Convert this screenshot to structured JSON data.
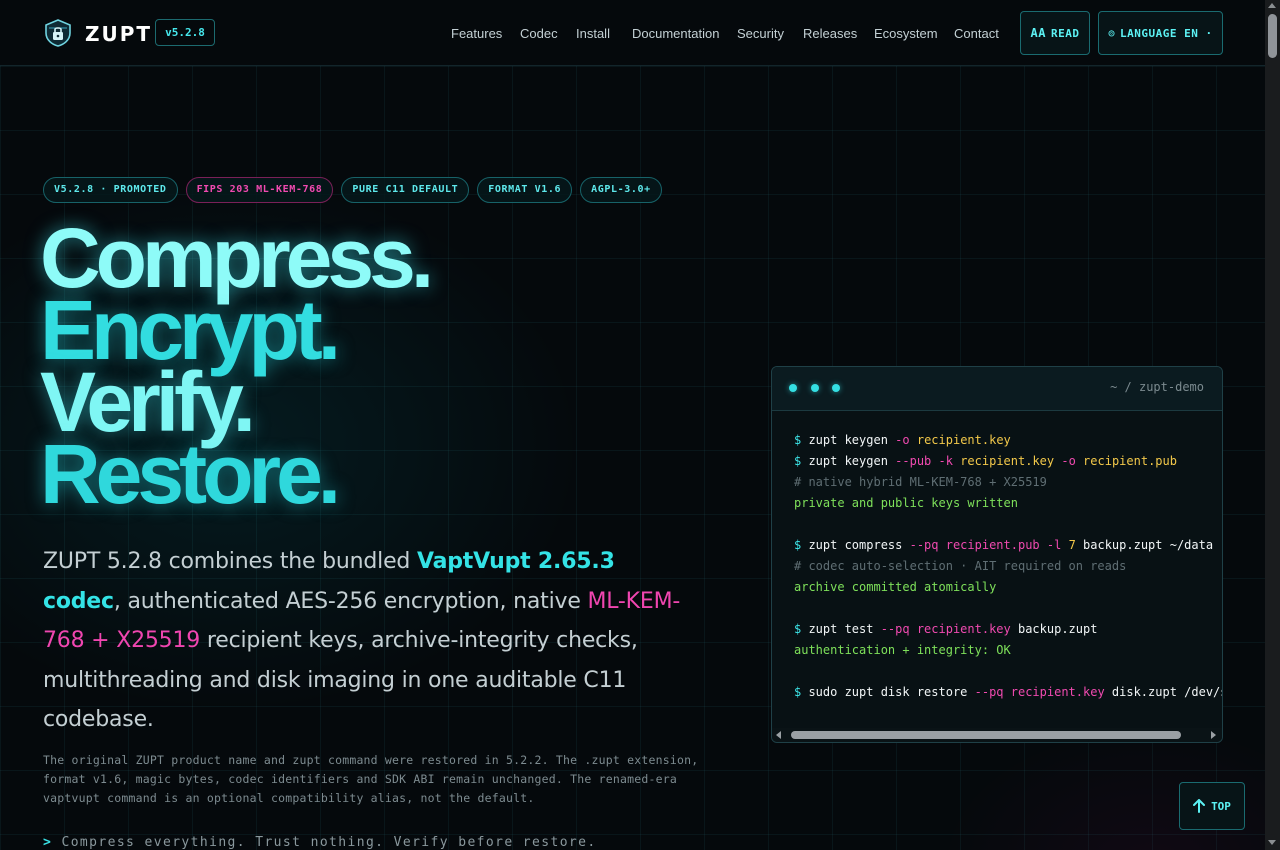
{
  "header": {
    "brand": "ZUPT",
    "version": "v5.2.8",
    "nav": [
      {
        "label": "Features"
      },
      {
        "label": "Codec"
      },
      {
        "label": "Install"
      },
      {
        "label": "Documentation"
      },
      {
        "label": "Security"
      },
      {
        "label": "Releases"
      },
      {
        "label": "Ecosystem"
      },
      {
        "label": "Contact"
      }
    ],
    "read_label": "READ",
    "read_icon_text": "AA",
    "language_label": "LANGUAGE EN ·",
    "language_icon_text": "◎"
  },
  "badges": [
    {
      "label": "V5.2.8 · PROMOTED",
      "accent": "cyan"
    },
    {
      "label": "FIPS 203 ML-KEM-768",
      "accent": "pink"
    },
    {
      "label": "PURE C11 DEFAULT",
      "accent": "cyan"
    },
    {
      "label": "FORMAT V1.6",
      "accent": "cyan"
    },
    {
      "label": "AGPL-3.0+",
      "accent": "cyan"
    }
  ],
  "hero": {
    "line1": "Compress.",
    "line2": "Encrypt.",
    "line3": "Verify.",
    "line4": "Restore."
  },
  "lead": {
    "part1": "ZUPT 5.2.8 combines the bundled ",
    "codec": "VaptVupt 2.65.3 codec",
    "part2": ", authenticated AES-256 encryption, native ",
    "pq": "ML-KEM-768 + X25519",
    "part3": " recipient keys, archive-integrity checks, multithreading and disk imaging in one auditable C11 codebase."
  },
  "note": "The original ZUPT product name and zupt command were restored in 5.2.2. The .zupt extension, format v1.6, magic bytes, codec identifiers and SDK ABI remain unchanged. The renamed-era vaptvupt command is an optional compatibility alias, not the default.",
  "tagline": {
    "prompt": ">",
    "text": "Compress everything. Trust nothing. Verify before restore."
  },
  "terminal": {
    "title": "~ / zupt-demo",
    "lines": [
      {
        "type": "cmd",
        "parts": [
          [
            "ps",
            "$ "
          ],
          [
            "cmd",
            "zupt keygen "
          ],
          [
            "flag",
            "-o "
          ],
          [
            "arg",
            "recipient.key"
          ]
        ]
      },
      {
        "type": "cmd",
        "parts": [
          [
            "ps",
            "$ "
          ],
          [
            "cmd",
            "zupt keygen "
          ],
          [
            "flag",
            "--pub "
          ],
          [
            "flag",
            "-k "
          ],
          [
            "arg",
            "recipient.key "
          ],
          [
            "flag",
            "-o "
          ],
          [
            "arg",
            "recipient.pub"
          ]
        ]
      },
      {
        "type": "comment",
        "parts": [
          [
            "cm",
            "# native hybrid ML-KEM-768 + X25519"
          ]
        ]
      },
      {
        "type": "out",
        "parts": [
          [
            "ok",
            "private and public keys written"
          ]
        ]
      },
      {
        "type": "blank",
        "parts": []
      },
      {
        "type": "cmd",
        "parts": [
          [
            "ps",
            "$ "
          ],
          [
            "cmd",
            "zupt compress "
          ],
          [
            "flag",
            "--pq "
          ],
          [
            "flag",
            "recipient.pub "
          ],
          [
            "flag",
            "-l "
          ],
          [
            "arg",
            "7 "
          ],
          [
            "cmd",
            "backup.zupt ~/data"
          ]
        ]
      },
      {
        "type": "comment",
        "parts": [
          [
            "cm",
            "# codec auto-selection · AIT required on reads"
          ]
        ]
      },
      {
        "type": "out",
        "parts": [
          [
            "ok",
            "archive committed atomically"
          ]
        ]
      },
      {
        "type": "blank",
        "parts": []
      },
      {
        "type": "cmd",
        "parts": [
          [
            "ps",
            "$ "
          ],
          [
            "cmd",
            "zupt test "
          ],
          [
            "flag",
            "--pq "
          ],
          [
            "flag",
            "recipient.key "
          ],
          [
            "cmd",
            "backup.zupt"
          ]
        ]
      },
      {
        "type": "out",
        "parts": [
          [
            "ok",
            "authentication + integrity: OK"
          ]
        ]
      },
      {
        "type": "blank",
        "parts": []
      },
      {
        "type": "cmd",
        "parts": [
          [
            "ps",
            "$ "
          ],
          [
            "cmd",
            "sudo zupt disk restore "
          ],
          [
            "flag",
            "--pq "
          ],
          [
            "flag",
            "recipient.key "
          ],
          [
            "cmd",
            "disk.zupt /dev/sdb"
          ]
        ]
      }
    ]
  },
  "top_button": {
    "label": "TOP",
    "icon": "arrow-up-icon"
  },
  "colors": {
    "background": "#05090c",
    "accent_cyan": "#34e3e6",
    "accent_pink": "#f046b0",
    "ok_green": "#7ee05a",
    "arg_yellow": "#f2c84a"
  }
}
